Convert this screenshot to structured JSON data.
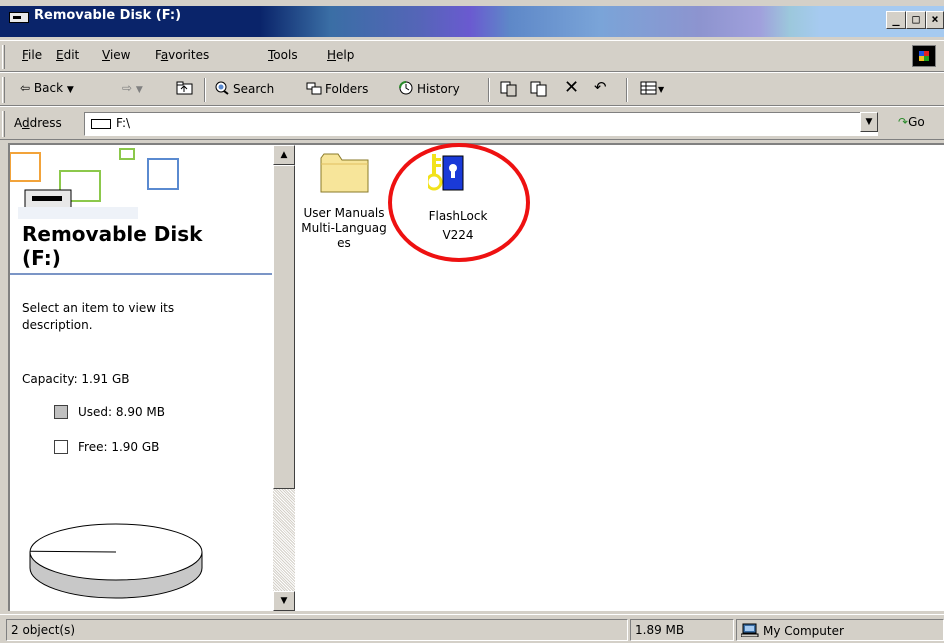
{
  "window": {
    "title": "Removable Disk (F:)"
  },
  "menu": {
    "items": [
      {
        "label": "File",
        "accel": "F",
        "rest": "ile"
      },
      {
        "label": "Edit",
        "accel": "E",
        "rest": "dit"
      },
      {
        "label": "View",
        "accel": "V",
        "rest": "iew"
      },
      {
        "label": "Favorites",
        "pre": "F",
        "accel": "a",
        "rest": "vorites"
      },
      {
        "label": "Tools",
        "accel": "T",
        "rest": "ools"
      },
      {
        "label": "Help",
        "accel": "H",
        "rest": "elp"
      }
    ]
  },
  "toolbar": {
    "back_label": "Back",
    "search_label": "Search",
    "folders_label": "Folders",
    "history_label": "History"
  },
  "address": {
    "label_pre": "A",
    "label_accel": "d",
    "label_rest": "dress",
    "value": "F:\\",
    "go_label": "Go"
  },
  "left_pane": {
    "title_line1": "Removable Disk",
    "title_line2": "(F:)",
    "description": "Select an item to view its description.",
    "capacity": "Capacity: 1.91 GB",
    "used": "Used: 8.90 MB",
    "free": "Free: 1.90 GB",
    "used_fraction": 0.0046
  },
  "files": [
    {
      "name": "User Manuals Multi-Languages",
      "line1": "User Manuals",
      "line2": "Multi-Languag",
      "line3": "es",
      "icon": "folder-icon"
    },
    {
      "name": "FlashLock V224",
      "line1": "FlashLock",
      "line2": "V224",
      "icon": "flashlock-key-icon"
    }
  ],
  "status": {
    "objects": "2 object(s)",
    "size": "1.89 MB",
    "zone": "My Computer"
  },
  "colors": {
    "title_active": "#0a246a",
    "highlight_circle": "#ee1111",
    "pane_rule": "#7b95c6"
  }
}
